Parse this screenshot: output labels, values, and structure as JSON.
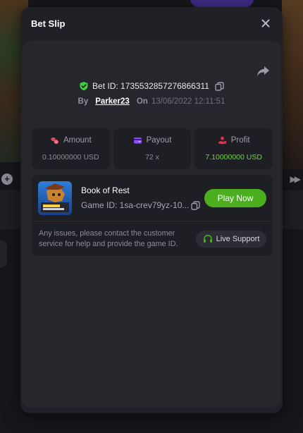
{
  "modal": {
    "title": "Bet Slip"
  },
  "bet": {
    "id_text": "Bet ID: 1735532857276866311",
    "by_label": "By",
    "user": "Parker23",
    "on_label": "On",
    "date": "13/06/2022 12:11:51"
  },
  "stats": {
    "amount_label": "Amount",
    "amount_value": "0.10000000 USD",
    "payout_label": "Payout",
    "payout_value": "72 x",
    "profit_label": "Profit",
    "profit_value": "7.10000000 USD"
  },
  "game": {
    "name": "Book of Rest",
    "id_text": "Game ID: 1sa-crev79yz-10...",
    "play_label": "Play Now",
    "help_text": "Any issues, please contact the customer service for help and provide the game ID.",
    "support_label": "Live Support"
  },
  "colors": {
    "accent_green": "#4caf1f",
    "profit_green": "#6fd440",
    "amount_icon": "#e8475a",
    "payout_icon": "#8a4dff",
    "profit_icon": "#e0344a"
  },
  "icons": [
    "close-icon",
    "share-icon",
    "shield-check-icon",
    "copy-icon",
    "amount-icon",
    "payout-icon",
    "profit-icon",
    "headset-icon"
  ]
}
